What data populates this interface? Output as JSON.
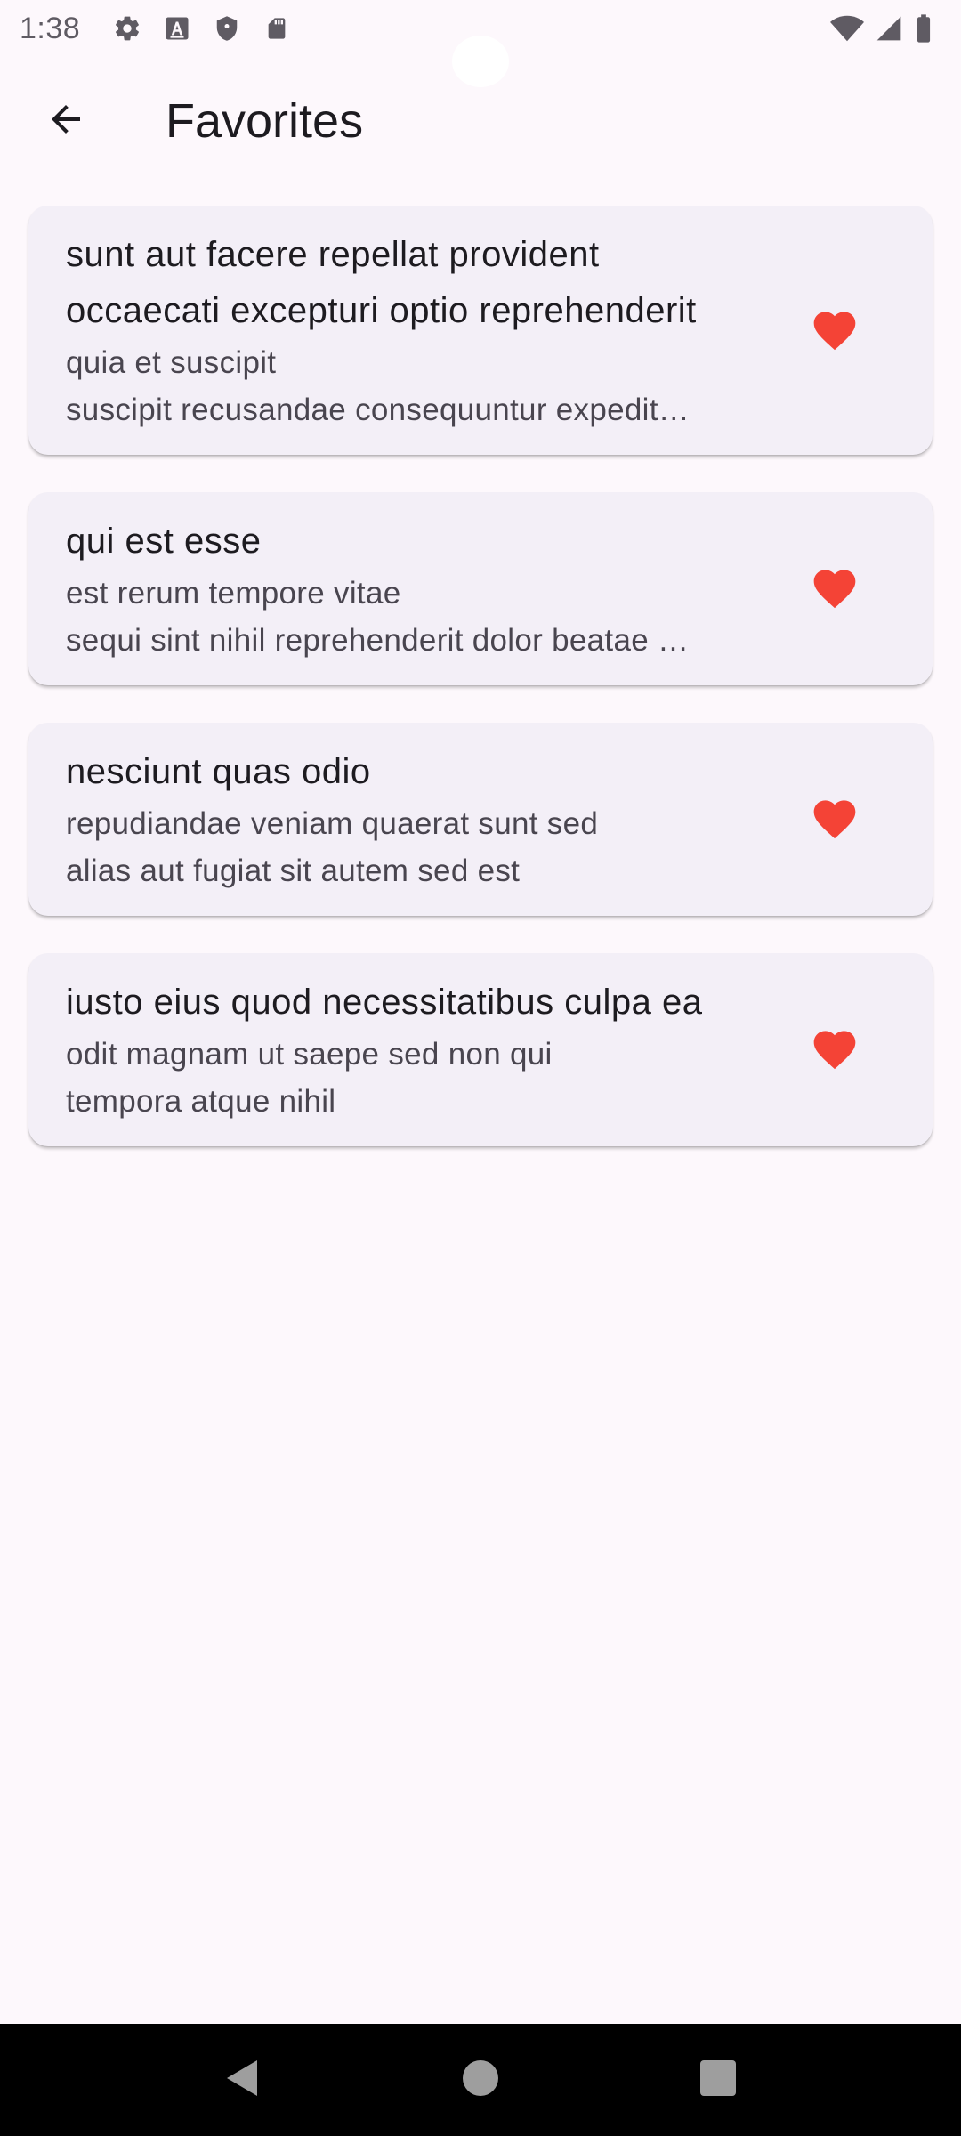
{
  "status_bar": {
    "time": "1:38",
    "icons": [
      "gear-icon",
      "text-a-icon",
      "shield-icon",
      "sd-card-icon",
      "wifi-icon",
      "signal-icon",
      "battery-icon"
    ]
  },
  "app_bar": {
    "title": "Favorites",
    "back_icon": "arrow-back-icon"
  },
  "colors": {
    "background": "#fdf8fc",
    "card": "#f3eff7",
    "heart": "#f44336",
    "nav_bar": "#000000"
  },
  "favorites": [
    {
      "title": "sunt aut facere repellat provident occaecati excepturi optio reprehenderit",
      "body": "quia et suscipit\nsuscipit recusandae consequuntur expedit…",
      "icon": "heart-icon"
    },
    {
      "title": "qui est esse",
      "body": "est rerum tempore vitae\nsequi sint nihil reprehenderit dolor beatae …",
      "icon": "heart-icon"
    },
    {
      "title": "nesciunt quas odio",
      "body": "repudiandae veniam quaerat sunt sed\nalias aut fugiat sit autem sed est",
      "icon": "heart-icon"
    },
    {
      "title": "iusto eius quod necessitatibus culpa ea",
      "body": "odit magnam ut saepe sed non qui\ntempora atque nihil",
      "icon": "heart-icon"
    }
  ],
  "nav_bar": {
    "buttons": [
      "back-triangle-icon",
      "home-circle-icon",
      "recents-square-icon"
    ]
  }
}
